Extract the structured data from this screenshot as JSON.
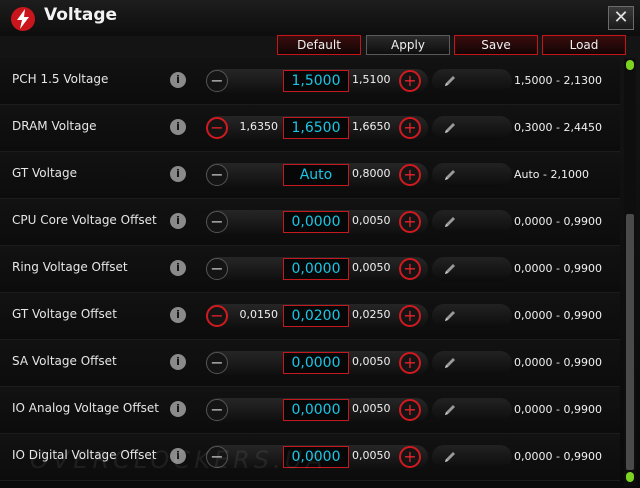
{
  "window": {
    "title": "Voltage",
    "close_label": "✕"
  },
  "toolbar": {
    "default_label": "Default",
    "apply_label": "Apply",
    "save_label": "Save",
    "load_label": "Load"
  },
  "rows": [
    {
      "label": "PCH 1.5 Voltage",
      "prev": "",
      "value": "1,5000",
      "next": "1,5100",
      "range": "1,5000 - 2,1300",
      "minus_active": false
    },
    {
      "label": "DRAM Voltage",
      "prev": "1,6350",
      "value": "1,6500",
      "next": "1,6650",
      "range": "0,3000 - 2,4450",
      "minus_active": true
    },
    {
      "label": "GT Voltage",
      "prev": "",
      "value": "Auto",
      "next": "0,8000",
      "range": "Auto - 2,1000",
      "minus_active": false
    },
    {
      "label": "CPU Core Voltage Offset",
      "prev": "",
      "value": "0,0000",
      "next": "0,0050",
      "range": "0,0000 - 0,9900",
      "minus_active": false
    },
    {
      "label": "Ring Voltage Offset",
      "prev": "",
      "value": "0,0000",
      "next": "0,0050",
      "range": "0,0000 - 0,9900",
      "minus_active": false
    },
    {
      "label": "GT Voltage Offset",
      "prev": "0,0150",
      "value": "0,0200",
      "next": "0,0250",
      "range": "0,0000 - 0,9900",
      "minus_active": true
    },
    {
      "label": "SA Voltage Offset",
      "prev": "",
      "value": "0,0000",
      "next": "0,0050",
      "range": "0,0000 - 0,9900",
      "minus_active": false
    },
    {
      "label": "IO Analog Voltage Offset",
      "prev": "",
      "value": "0,0000",
      "next": "0,0050",
      "range": "0,0000 - 0,9900",
      "minus_active": false
    },
    {
      "label": "IO Digital Voltage Offset",
      "prev": "",
      "value": "0,0000",
      "next": "0,0050",
      "range": "0,0000 - 0,9900",
      "minus_active": false
    }
  ],
  "glyphs": {
    "info": "i",
    "minus": "−",
    "plus": "+"
  },
  "colors": {
    "accent": "#d01a20",
    "value_text": "#19c6e6",
    "scroll_cap": "#7dd321"
  },
  "watermark": "OVERCLOCKERS.UA"
}
